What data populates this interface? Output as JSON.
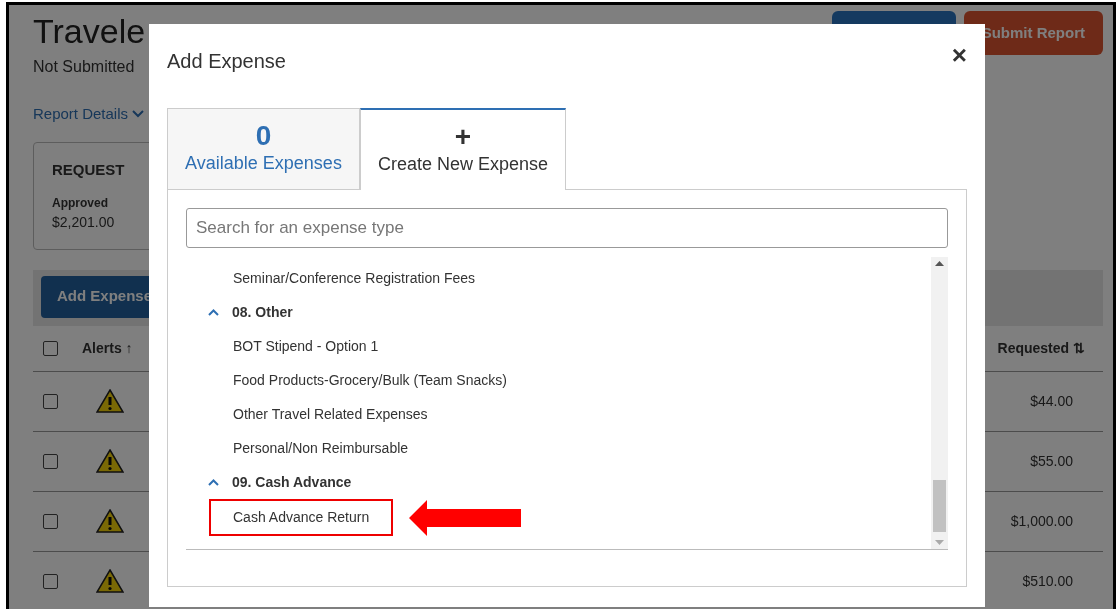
{
  "page": {
    "title": "Travele",
    "status": "Not Submitted",
    "report_details": "Report Details",
    "submit_button": "Submit Report",
    "request_card": {
      "heading": "REQUEST",
      "label": "Approved",
      "amount": "$2,201.00"
    },
    "add_expense_button": "Add Expense",
    "table": {
      "select_all_checked": false,
      "columns": [
        {
          "label": "Alerts",
          "sort": "↑"
        },
        {
          "label": "Requested",
          "sort": "⇅"
        }
      ],
      "rows": [
        {
          "checked": false,
          "alert": true,
          "amount": "$44.00"
        },
        {
          "checked": false,
          "alert": true,
          "amount": "$55.00"
        },
        {
          "checked": false,
          "alert": true,
          "amount": "$1,000.00"
        },
        {
          "checked": false,
          "alert": true,
          "amount": "$510.00"
        }
      ]
    }
  },
  "dialog": {
    "title": "Add Expense",
    "close": "×",
    "tabs": [
      {
        "count": "0",
        "label": "Available Expenses",
        "selected": false
      },
      {
        "count": "+",
        "label": "Create New Expense",
        "selected": true
      }
    ],
    "search": {
      "placeholder": "Search for an expense type"
    },
    "items": [
      {
        "kind": "item",
        "label": "Seminar/Conference Registration Fees",
        "highlighted": false
      },
      {
        "kind": "category",
        "label": "08. Other",
        "expanded": true,
        "children": [
          {
            "kind": "item",
            "label": "BOT Stipend - Option 1",
            "highlighted": false
          },
          {
            "kind": "item",
            "label": "Food Products-Grocery/Bulk (Team Snacks)",
            "highlighted": false
          },
          {
            "kind": "item",
            "label": "Other Travel Related Expenses",
            "highlighted": false
          },
          {
            "kind": "item",
            "label": "Personal/Non Reimbursable",
            "highlighted": false
          }
        ]
      },
      {
        "kind": "category",
        "label": "09. Cash Advance",
        "expanded": true,
        "children": [
          {
            "kind": "item",
            "label": "Cash Advance Return",
            "highlighted": true
          }
        ]
      }
    ]
  }
}
